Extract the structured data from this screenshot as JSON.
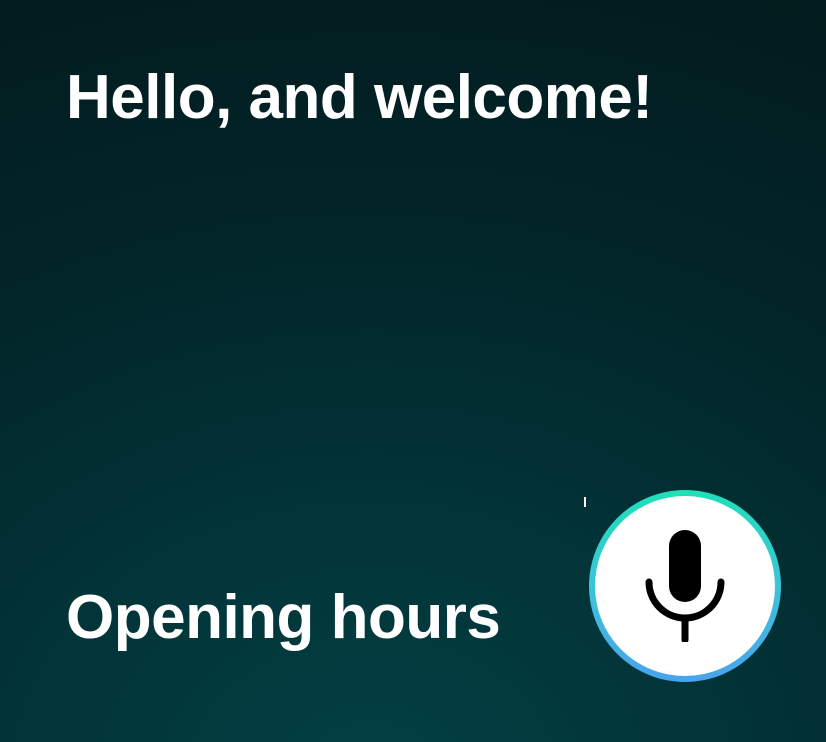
{
  "greeting": "Hello, and welcome!",
  "suggestion": "Opening hours",
  "mic_button": {
    "icon": "microphone-icon",
    "ring_gradient": [
      "#1fe0b8",
      "#4aa3ec"
    ],
    "background": "#ffffff"
  },
  "colors": {
    "background_dark": "#021a1c",
    "background_teal": "#024044",
    "text": "#ffffff"
  }
}
